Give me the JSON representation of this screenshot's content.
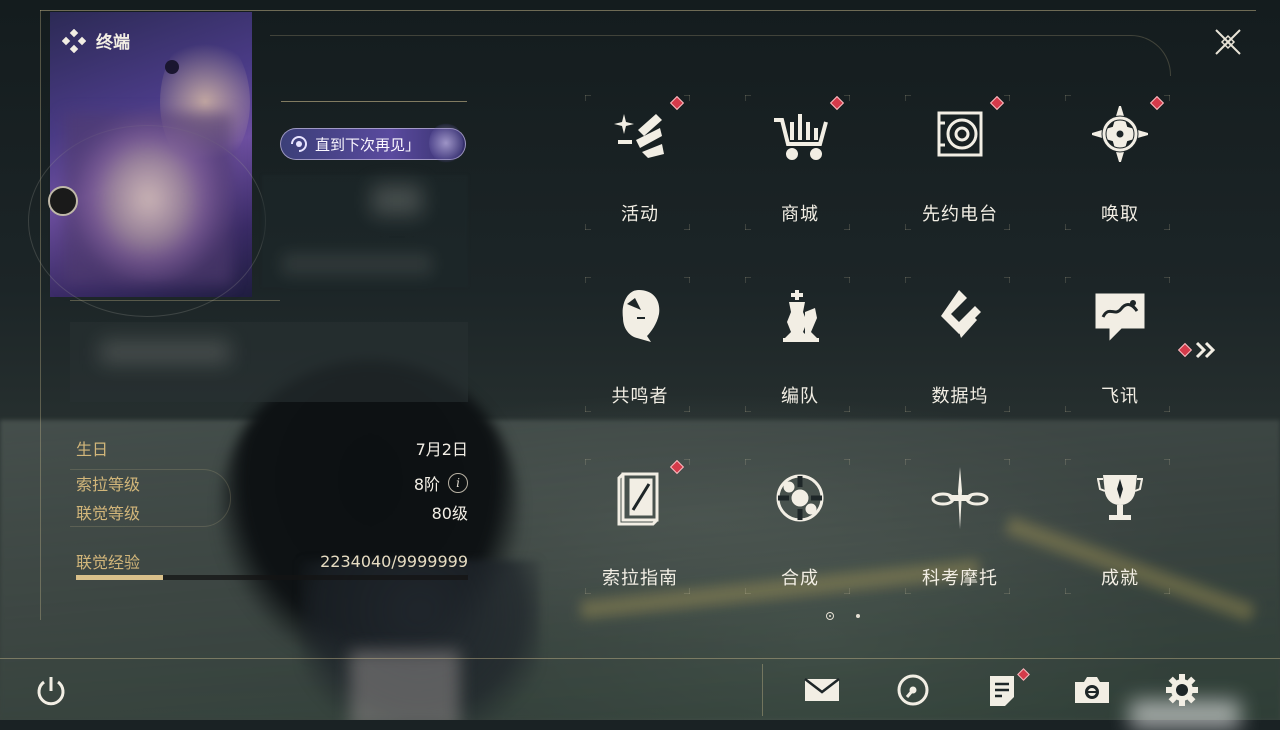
{
  "header": {
    "title": "终端"
  },
  "profile": {
    "signature": "直到下次再见」",
    "stats": [
      {
        "key": "生日",
        "value": "7月2日"
      },
      {
        "key": "索拉等级",
        "value": "8阶"
      },
      {
        "key": "联觉等级",
        "value": "80级"
      },
      {
        "key": "联觉经验",
        "value": "2234040/9999999"
      }
    ],
    "exp_fraction": 0.223
  },
  "menu": {
    "items": [
      {
        "label": "活动",
        "icon": "event-sparkle-icon",
        "badge": true
      },
      {
        "label": "商城",
        "icon": "shop-cart-icon",
        "badge": true
      },
      {
        "label": "先约电台",
        "icon": "radio-icon",
        "badge": true
      },
      {
        "label": "唤取",
        "icon": "convene-star-icon",
        "badge": true
      },
      {
        "label": "共鸣者",
        "icon": "resonator-head-icon",
        "badge": false
      },
      {
        "label": "编队",
        "icon": "team-chess-icon",
        "badge": false
      },
      {
        "label": "数据坞",
        "icon": "databank-icon",
        "badge": false
      },
      {
        "label": "飞讯",
        "icon": "message-chat-icon",
        "badge": false
      },
      {
        "label": "索拉指南",
        "icon": "guide-book-icon",
        "badge": true
      },
      {
        "label": "合成",
        "icon": "synthesis-icon",
        "badge": false
      },
      {
        "label": "科考摩托",
        "icon": "motorcycle-icon",
        "badge": false
      },
      {
        "label": "成就",
        "icon": "achievement-trophy-icon",
        "badge": false
      }
    ],
    "pages": 2,
    "current_page": 1
  },
  "toolbar": {
    "buttons": [
      {
        "name": "mail-icon",
        "badge": false
      },
      {
        "name": "clock-icon",
        "badge": false
      },
      {
        "name": "notice-icon",
        "badge": true
      },
      {
        "name": "camera-icon",
        "badge": false
      },
      {
        "name": "settings-gear-icon",
        "badge": false
      }
    ]
  },
  "colors": {
    "accent_gold": "#d2b67a",
    "badge_red": "#d43a4a",
    "text": "#f2eee4"
  }
}
